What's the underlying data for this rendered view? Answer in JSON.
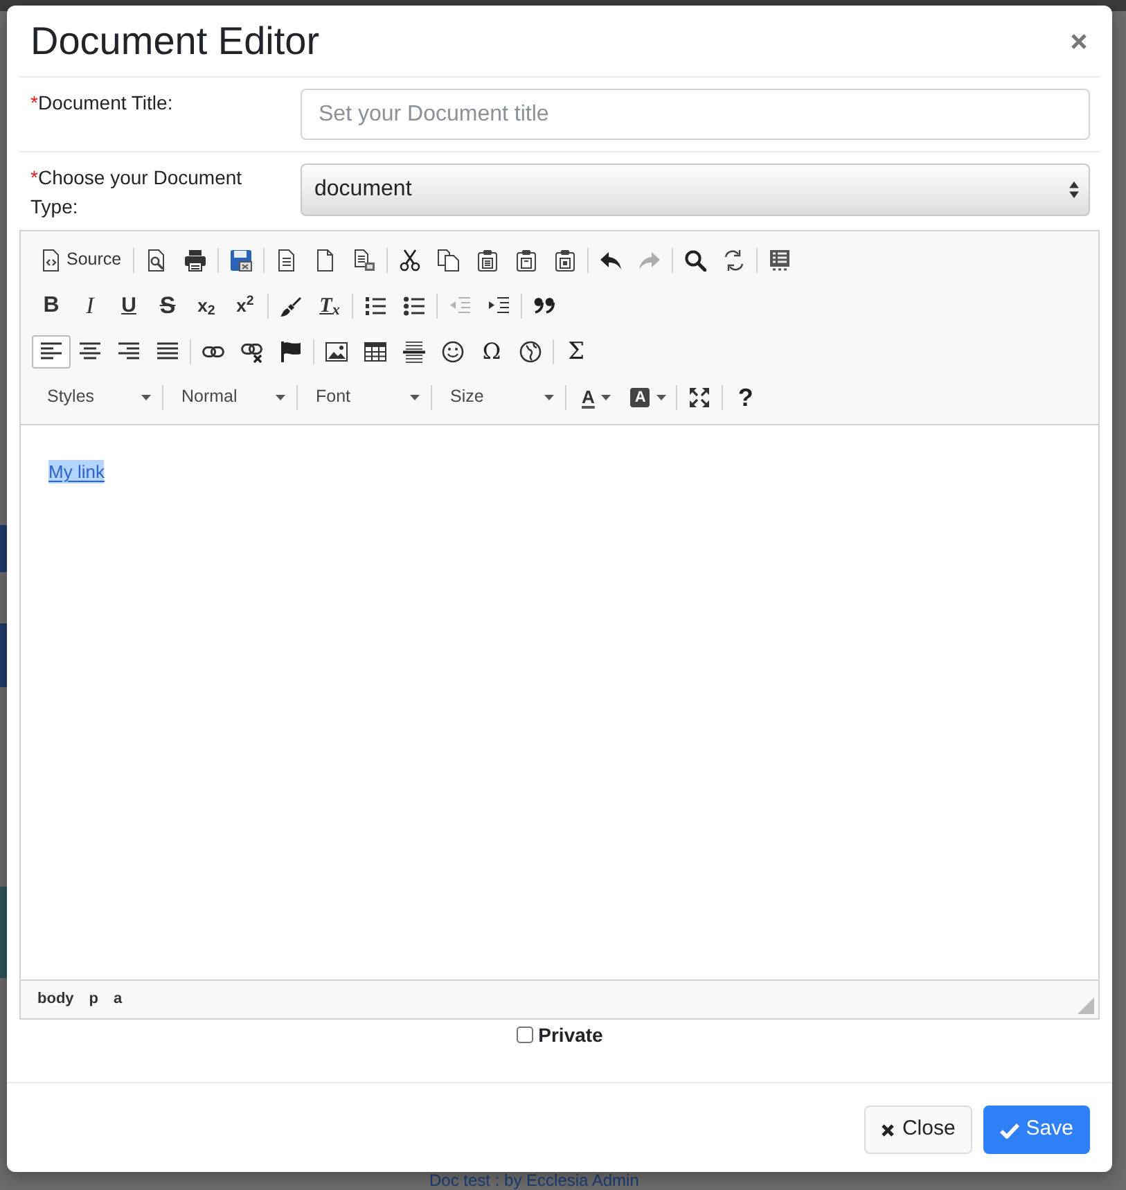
{
  "dialog": {
    "title": "Document Editor"
  },
  "fields": [
    {
      "kind": "text",
      "required_mark": "*",
      "label": "Document Title:",
      "placeholder": "Set your Document title"
    },
    {
      "kind": "select",
      "required_mark": "*",
      "label": "Choose your Document Type:",
      "value": "document"
    }
  ],
  "editor": {
    "toolbar": [
      {
        "groups": [
          [
            {
              "kind": "source",
              "label": "Source",
              "on": false,
              "disabled": false
            }
          ],
          [
            {
              "kind": "preview",
              "on": false,
              "disabled": false
            },
            {
              "kind": "print",
              "on": false,
              "disabled": false
            }
          ],
          [
            {
              "kind": "save",
              "on": false,
              "disabled": false
            }
          ],
          [
            {
              "kind": "templates",
              "on": false,
              "disabled": false
            },
            {
              "kind": "newpage",
              "on": false,
              "disabled": false
            },
            {
              "kind": "exportdoc",
              "on": false,
              "disabled": false
            }
          ],
          [
            {
              "kind": "cut",
              "on": false,
              "disabled": false
            },
            {
              "kind": "copy",
              "on": false,
              "disabled": false
            },
            {
              "kind": "paste",
              "on": false,
              "disabled": false
            },
            {
              "kind": "pastetext",
              "on": false,
              "disabled": false
            },
            {
              "kind": "pasteword",
              "on": false,
              "disabled": false
            }
          ],
          [
            {
              "kind": "undo",
              "on": false,
              "disabled": false
            },
            {
              "kind": "redo",
              "on": false,
              "disabled": true
            }
          ],
          [
            {
              "kind": "find",
              "on": false,
              "disabled": false
            },
            {
              "kind": "replace",
              "on": false,
              "disabled": false
            }
          ],
          [
            {
              "kind": "showblocks",
              "on": false,
              "disabled": false
            }
          ]
        ]
      },
      {
        "groups": [
          [
            {
              "kind": "bold",
              "glyph": "B",
              "on": false,
              "disabled": false
            },
            {
              "kind": "italic",
              "glyph": "I",
              "on": false,
              "disabled": false
            },
            {
              "kind": "underline",
              "glyph": "U",
              "on": false,
              "disabled": false
            },
            {
              "kind": "strike",
              "glyph": "S",
              "on": false,
              "disabled": false
            },
            {
              "kind": "subscript",
              "glyph": "x$_{2}$",
              "on": false,
              "disabled": false
            },
            {
              "kind": "superscript",
              "glyph": "x$^{2}$",
              "on": false,
              "disabled": false
            }
          ],
          [
            {
              "kind": "copyformatting",
              "on": false,
              "disabled": false
            },
            {
              "kind": "removeformat",
              "glyph": "T$_{x}$",
              "on": false,
              "disabled": false
            }
          ],
          [
            {
              "kind": "numberedlist",
              "on": false,
              "disabled": false
            },
            {
              "kind": "bulletlist",
              "on": false,
              "disabled": false
            }
          ],
          [
            {
              "kind": "outdent",
              "on": false,
              "disabled": true
            },
            {
              "kind": "indent",
              "on": false,
              "disabled": false
            }
          ],
          [
            {
              "kind": "blockquote",
              "on": false,
              "disabled": false
            }
          ]
        ]
      },
      {
        "groups": [
          [
            {
              "kind": "justifyleft",
              "on": true,
              "disabled": false
            },
            {
              "kind": "justifycenter",
              "on": false,
              "disabled": false
            },
            {
              "kind": "justifyright",
              "on": false,
              "disabled": false
            },
            {
              "kind": "justifyblock",
              "on": false,
              "disabled": false
            }
          ],
          [
            {
              "kind": "link",
              "on": false,
              "disabled": false
            },
            {
              "kind": "unlink",
              "on": false,
              "disabled": false
            },
            {
              "kind": "anchor",
              "on": false,
              "disabled": false
            }
          ],
          [
            {
              "kind": "image",
              "on": false,
              "disabled": false
            },
            {
              "kind": "table",
              "on": false,
              "disabled": false
            },
            {
              "kind": "horizontalrule",
              "on": false,
              "disabled": false
            },
            {
              "kind": "smiley",
              "on": false,
              "disabled": false
            },
            {
              "kind": "specialchar",
              "glyph": "Ω",
              "on": false,
              "disabled": false
            },
            {
              "kind": "iframe",
              "on": false,
              "disabled": false
            }
          ],
          [
            {
              "kind": "mathjax",
              "glyph": "Σ",
              "on": false,
              "disabled": false
            }
          ]
        ]
      },
      {
        "groups": [
          [
            {
              "kind": "combo",
              "label": "Styles",
              "disabled": false
            }
          ],
          [
            {
              "kind": "combo",
              "label": "Normal",
              "disabled": false
            }
          ],
          [
            {
              "kind": "combo",
              "label": "Font",
              "disabled": false
            }
          ],
          [
            {
              "kind": "combo",
              "label": "Size",
              "disabled": false
            }
          ],
          [
            {
              "kind": "textcolor",
              "glyph": "A",
              "on": false,
              "disabled": false
            },
            {
              "kind": "bgcolor",
              "glyph": "A",
              "on": false,
              "disabled": false
            }
          ],
          [
            {
              "kind": "maximize",
              "on": false,
              "disabled": false
            }
          ],
          [
            {
              "kind": "help",
              "glyph": "?",
              "on": false,
              "disabled": false
            }
          ]
        ]
      }
    ],
    "content": [
      {
        "kind": "link",
        "text": "My link",
        "highlighted": true
      }
    ],
    "path": [
      "body",
      "p",
      "a"
    ]
  },
  "private": {
    "label": "Private",
    "checked": false
  },
  "buttons": [
    {
      "kind": "secondary",
      "label": "Close"
    },
    {
      "kind": "primary",
      "label": "Save"
    }
  ],
  "background": {
    "link": "Doc test : by Ecclesia Admin"
  }
}
